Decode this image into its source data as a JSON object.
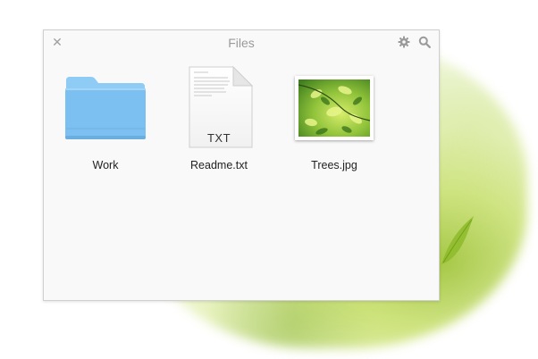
{
  "window": {
    "title": "Files",
    "close_icon": "close-icon",
    "settings_icon": "gear-icon",
    "search_icon": "search-icon"
  },
  "files": [
    {
      "name": "Work",
      "kind": "folder",
      "icon": "folder-icon"
    },
    {
      "name": "Readme.txt",
      "kind": "text",
      "icon": "text-document-icon",
      "badge": "TXT"
    },
    {
      "name": "Trees.jpg",
      "kind": "image",
      "icon": "image-thumbnail-icon"
    }
  ],
  "colors": {
    "folder": "#7cc0f2",
    "folder_tab": "#8ecbf5",
    "title_text": "#9a9a9a",
    "window_bg": "#f9f9f9"
  }
}
